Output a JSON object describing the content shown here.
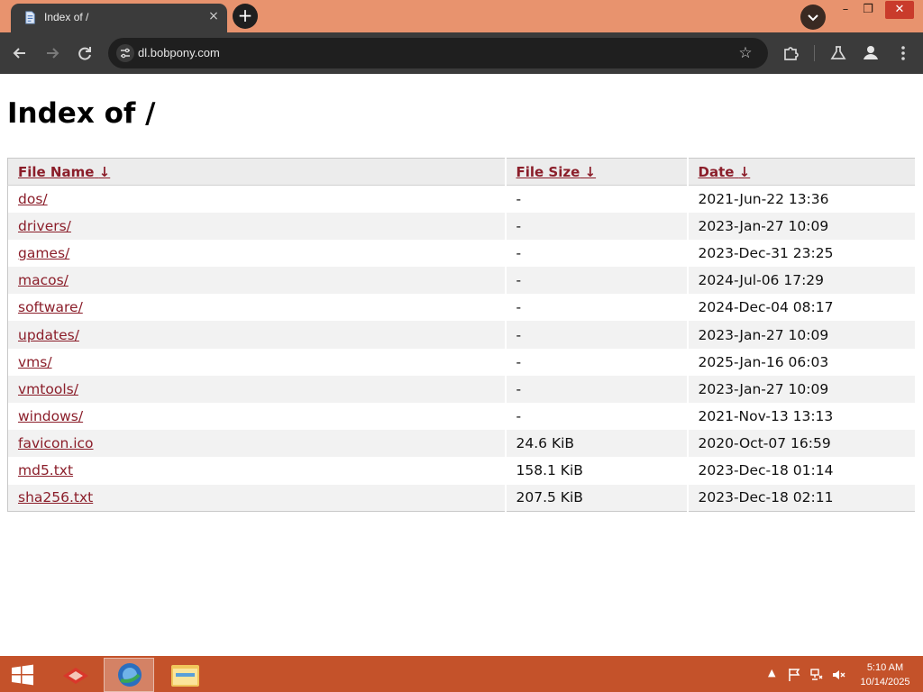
{
  "browser": {
    "tab_title": "Index of /",
    "new_tab_label": "+",
    "tab_close": "×",
    "url": "dl.bobpony.com",
    "window_controls": {
      "minimize": "–",
      "restore": "❐",
      "close": "✕"
    }
  },
  "page": {
    "heading": "Index of /",
    "columns": [
      {
        "label": "File Name",
        "sort": "↓"
      },
      {
        "label": "File Size",
        "sort": "↓"
      },
      {
        "label": "Date",
        "sort": "↓"
      }
    ],
    "rows": [
      {
        "name": "dos/",
        "size": "-",
        "date": "2021-Jun-22 13:36"
      },
      {
        "name": "drivers/",
        "size": "-",
        "date": "2023-Jan-27 10:09"
      },
      {
        "name": "games/",
        "size": "-",
        "date": "2023-Dec-31 23:25"
      },
      {
        "name": "macos/",
        "size": "-",
        "date": "2024-Jul-06 17:29"
      },
      {
        "name": "software/",
        "size": "-",
        "date": "2024-Dec-04 08:17"
      },
      {
        "name": "updates/",
        "size": "-",
        "date": "2023-Jan-27 10:09"
      },
      {
        "name": "vms/",
        "size": "-",
        "date": "2025-Jan-16 06:03"
      },
      {
        "name": "vmtools/",
        "size": "-",
        "date": "2023-Jan-27 10:09"
      },
      {
        "name": "windows/",
        "size": "-",
        "date": "2021-Nov-13 13:13"
      },
      {
        "name": "favicon.ico",
        "size": "24.6 KiB",
        "date": "2020-Oct-07 16:59"
      },
      {
        "name": "md5.txt",
        "size": "158.1 KiB",
        "date": "2023-Dec-18 01:14"
      },
      {
        "name": "sha256.txt",
        "size": "207.5 KiB",
        "date": "2023-Dec-18 02:11"
      }
    ]
  },
  "taskbar": {
    "time": "5:10 AM",
    "date": "10/14/2025",
    "tray_chevron": "▲"
  },
  "colors": {
    "titlebar": "#e8936e",
    "toolbar": "#3b3b3b",
    "link": "#8b1e2a",
    "taskbar": "#c4522a"
  }
}
